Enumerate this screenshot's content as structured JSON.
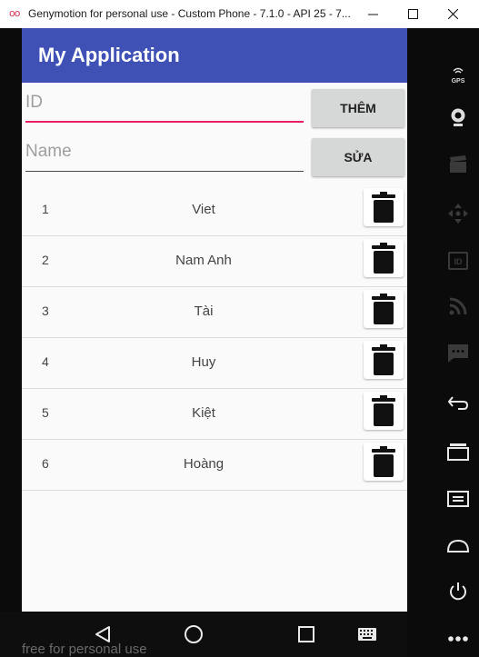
{
  "window": {
    "title": "Genymotion for personal use - Custom Phone - 7.1.0 - API 25 - 7..."
  },
  "app": {
    "title": "My Application",
    "accent_color": "#3f51b5",
    "focus_color": "#e91e63"
  },
  "form": {
    "id_placeholder": "ID",
    "id_value": "",
    "name_placeholder": "Name",
    "name_value": "",
    "add_label": "THÊM",
    "edit_label": "SỬA"
  },
  "rows": [
    {
      "id": "1",
      "name": "Viet"
    },
    {
      "id": "2",
      "name": "Nam Anh"
    },
    {
      "id": "3",
      "name": "Tài"
    },
    {
      "id": "4",
      "name": "Huy"
    },
    {
      "id": "5",
      "name": "Kiệt"
    },
    {
      "id": "6",
      "name": "Hoàng"
    }
  ],
  "toolbar": {
    "gps_label": "GPS",
    "id_label": "ID"
  },
  "watermark": "free for personal use",
  "icons": {
    "row_action": "trash-icon",
    "nav": [
      "back-icon",
      "home-icon",
      "recents-icon",
      "keyboard-icon"
    ]
  }
}
